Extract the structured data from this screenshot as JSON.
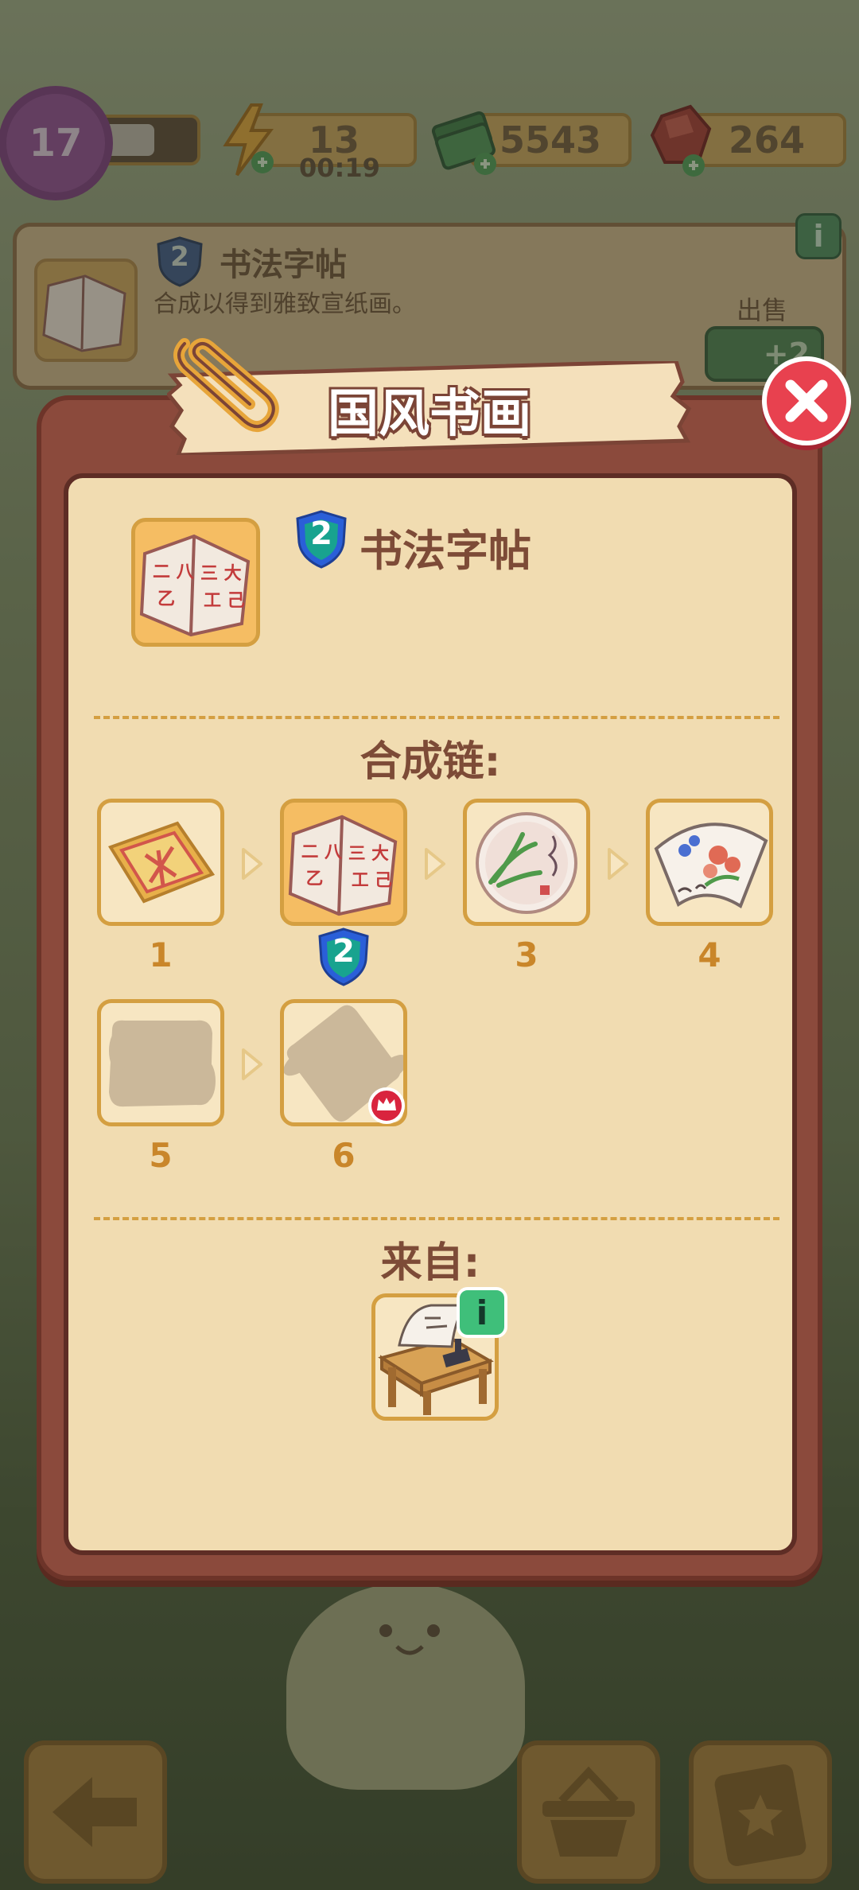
{
  "hud": {
    "level": "17",
    "xp_fraction": 0.6,
    "energy": "13",
    "energy_timer": "00:19",
    "cash": "5543",
    "gems": "264"
  },
  "item_info": {
    "level": "2",
    "name": "书法字帖",
    "description": "合成以得到雅致宣纸画。",
    "sell_label": "出售",
    "sell_value": "+2",
    "info_icon": "i"
  },
  "modal": {
    "title": "国风书画",
    "item": {
      "level": "2",
      "name": "书法字帖"
    },
    "chain_title": "合成链:",
    "chain": [
      {
        "label": "1",
        "icon": "red-paper-cut-icon",
        "state": "unlocked"
      },
      {
        "label": "2",
        "icon": "calligraphy-book-icon",
        "state": "current",
        "badge": "2"
      },
      {
        "label": "3",
        "icon": "orchid-plate-icon",
        "state": "unlocked"
      },
      {
        "label": "4",
        "icon": "flower-fan-icon",
        "state": "unlocked"
      },
      {
        "label": "5",
        "icon": "locked-scroll-icon",
        "state": "locked"
      },
      {
        "label": "6",
        "icon": "locked-scroll-icon",
        "state": "locked-max"
      }
    ],
    "source_title": "来自:",
    "source_icon": "calligraphy-desk-icon",
    "source_info_label": "i"
  },
  "colors": {
    "panel_frame": "#8b4a3c",
    "panel_inner": "#f1dcb1",
    "slot_border": "#d49f41",
    "title_text": "#7d4b37",
    "number_text": "#c9862a",
    "close_red": "#e8414f",
    "shield_blue": "#2a5fd8",
    "shield_teal": "#18a38f"
  }
}
